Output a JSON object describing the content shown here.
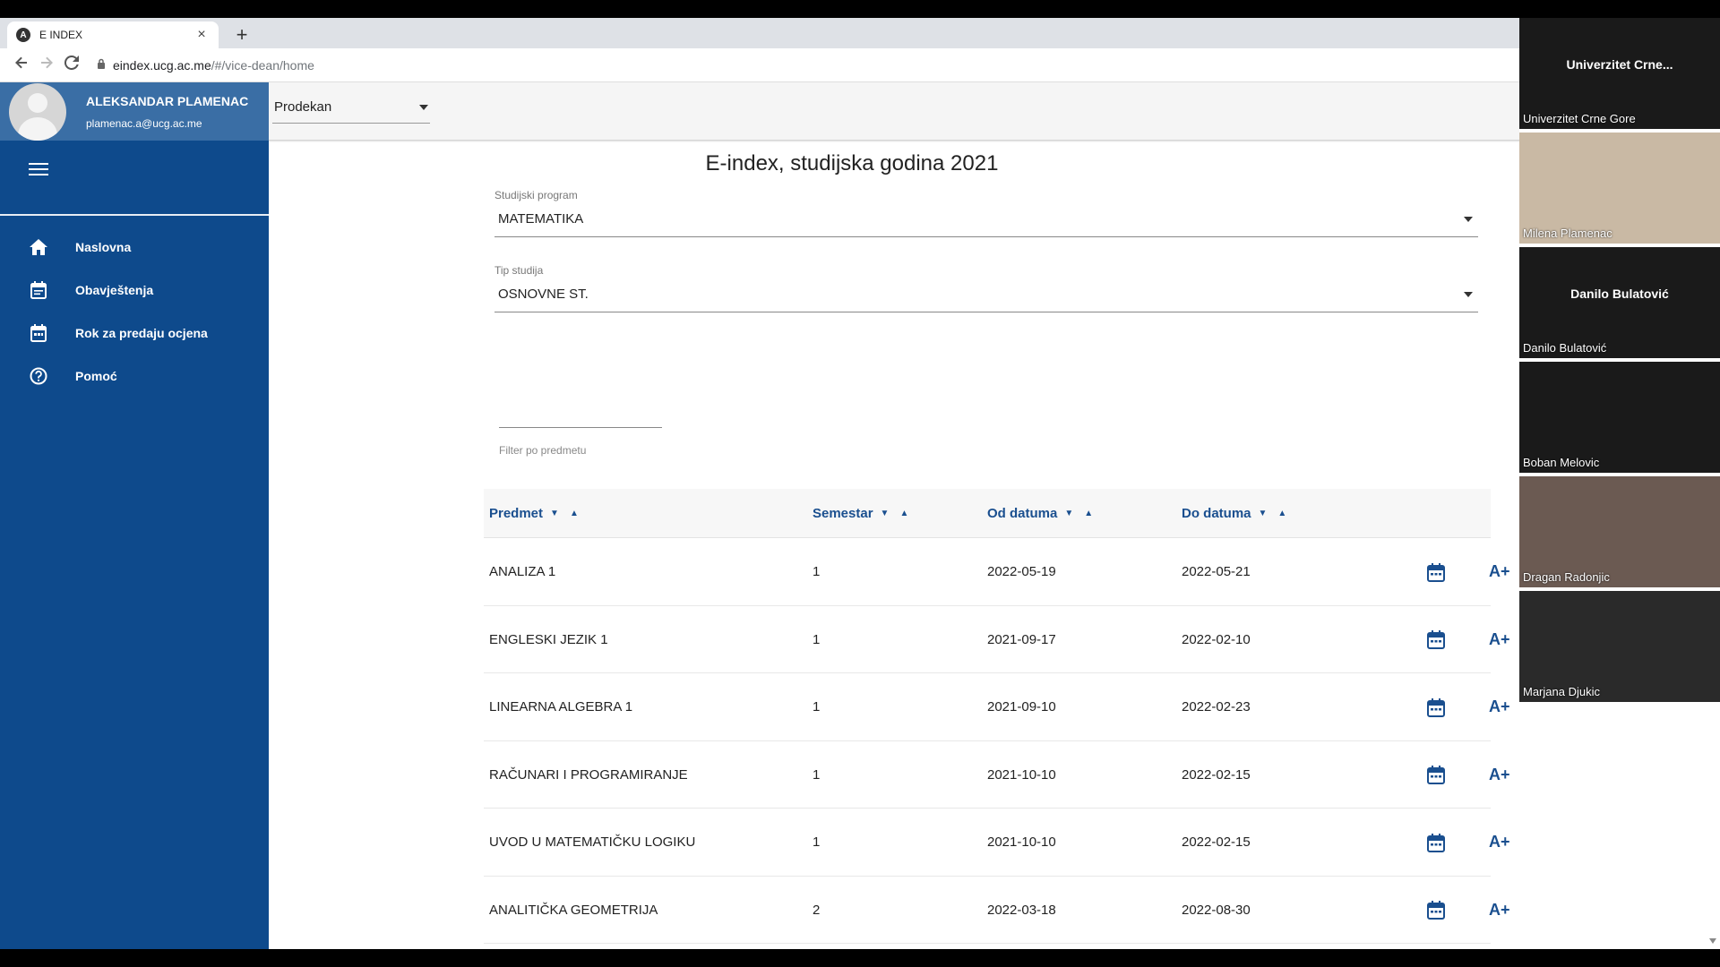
{
  "browser": {
    "tab_title": "E INDEX",
    "tab_favicon": "A",
    "close_glyph": "×",
    "newtab_glyph": "+",
    "url_host": "eindex.ucg.ac.me",
    "url_path": "/#/vice-dean/home"
  },
  "profile": {
    "name": "ALEKSANDAR PLAMENAC",
    "email": "plamenac.a@ucg.ac.me"
  },
  "role_select": {
    "value": "Prodekan"
  },
  "sidebar": {
    "items": [
      {
        "label": "Naslovna",
        "icon": "home-icon"
      },
      {
        "label": "Obavještenja",
        "icon": "notifications-calendar-icon"
      },
      {
        "label": "Rok za predaju ocjena",
        "icon": "calendar-icon"
      },
      {
        "label": "Pomoć",
        "icon": "help-circle-icon"
      }
    ]
  },
  "main": {
    "title": "E-index, studijska godina 2021",
    "program": {
      "label": "Studijski program",
      "value": "MATEMATIKA"
    },
    "study_type": {
      "label": "Tip studija",
      "value": "OSNOVNE ST."
    },
    "filter": {
      "label": "Filter po predmetu",
      "value": ""
    }
  },
  "table": {
    "headers": [
      "Predmet",
      "Semestar",
      "Od datuma",
      "Do datuma"
    ],
    "grade_action_label": "A+",
    "rows": [
      {
        "predmet": "ANALIZA 1",
        "semestar": "1",
        "od": "2022-05-19",
        "do": "2022-05-21"
      },
      {
        "predmet": "ENGLESKI JEZIK 1",
        "semestar": "1",
        "od": "2021-09-17",
        "do": "2022-02-10"
      },
      {
        "predmet": "LINEARNA ALGEBRA 1",
        "semestar": "1",
        "od": "2021-09-10",
        "do": "2022-02-23"
      },
      {
        "predmet": "RAČUNARI I PROGRAMIRANJE",
        "semestar": "1",
        "od": "2021-10-10",
        "do": "2022-02-15"
      },
      {
        "predmet": "UVOD U MATEMATIČKU LOGIKU",
        "semestar": "1",
        "od": "2021-10-10",
        "do": "2022-02-15"
      },
      {
        "predmet": "ANALITIČKA GEOMETRIJA",
        "semestar": "2",
        "od": "2022-03-18",
        "do": "2022-08-30"
      }
    ]
  },
  "participants": [
    {
      "name": "Univerzitet Crne Gore",
      "center_label": "Univerzitet  Crne...",
      "background": "#1a1a1a"
    },
    {
      "name": "Milena Plamenac",
      "center_label": "",
      "background": "#c9b9a4"
    },
    {
      "name": "Danilo Bulatović",
      "center_label": "Danilo Bulatović",
      "background": "#1a1a1a"
    },
    {
      "name": "Boban Melovic",
      "center_label": "",
      "background": "#1a1a1a"
    },
    {
      "name": "Dragan Radonjic",
      "center_label": "",
      "background": "#6b5a52"
    },
    {
      "name": "Marjana Djukic",
      "center_label": "",
      "background": "#2a2a2a"
    }
  ],
  "colors": {
    "sidebar": "#0e4a8c",
    "profile_band": "#3a6ea5",
    "accent": "#1a4f8f"
  }
}
